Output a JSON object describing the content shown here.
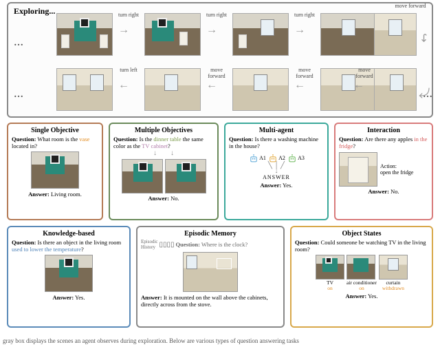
{
  "exploring_label": "Exploring...",
  "actions": {
    "tr": "turn\nright",
    "tl": "turn\nleft",
    "mf": "move\nforward"
  },
  "cards": {
    "single": {
      "title": "Single Objective",
      "q_pre": "Question:",
      "q1": " What room is the ",
      "q_hl": "vase",
      "q2": " located in?",
      "a_pre": "Answer:",
      "a": " Living room."
    },
    "multiple": {
      "title": "Multiple Objectives",
      "q_pre": "Question:",
      "q1": " Is the ",
      "hl1": "dinner table",
      "q2": " the same color as the ",
      "hl2": "TV cabinet",
      "q3": "?",
      "a_pre": "Answer:",
      "a": " No."
    },
    "multiagent": {
      "title": "Multi-agent",
      "q_pre": "Question:",
      "q": " Is there a washing machine in the house?",
      "a1": "A1",
      "a2": "A2",
      "a3": "A3",
      "ans_lbl": "ANSWER",
      "a_pre": "Answer:",
      "a": " Yes."
    },
    "interaction": {
      "title": "Interaction",
      "q_pre": "Question:",
      "q1": " Are there any apples ",
      "hl": "in the fridge",
      "q2": "?",
      "act": "Action:\nopen the fridge",
      "a_pre": "Answer:",
      "a": " No."
    },
    "knowledge": {
      "title": "Knowledge-based",
      "q_pre": "Question:",
      "q1": " Is there an object in the living room ",
      "hl": "used to lower the temperature",
      "q2": "?",
      "a_pre": "Answer:",
      "a": " Yes."
    },
    "episodic": {
      "title": "Episodic Memory",
      "hist": "Episodic\nHistory",
      "q_pre": "Question:",
      "q": " Where is the clock?",
      "a_pre": "Answer:",
      "a": " It is mounted on the wall above the cabinets, directly across from the stove."
    },
    "objstates": {
      "title": "Object States",
      "q_pre": "Question:",
      "q": " Could someone be watching TV in the living room?",
      "s1": "TV",
      "s1v": "on",
      "s2": "air conditioner",
      "s2v": "on",
      "s3": "curtain",
      "s3v": "withdrawn",
      "a_pre": "Answer:",
      "a": " Yes."
    }
  },
  "caption": "gray box displays the scenes an agent observes during exploration. Below are various types of question answering tasks"
}
